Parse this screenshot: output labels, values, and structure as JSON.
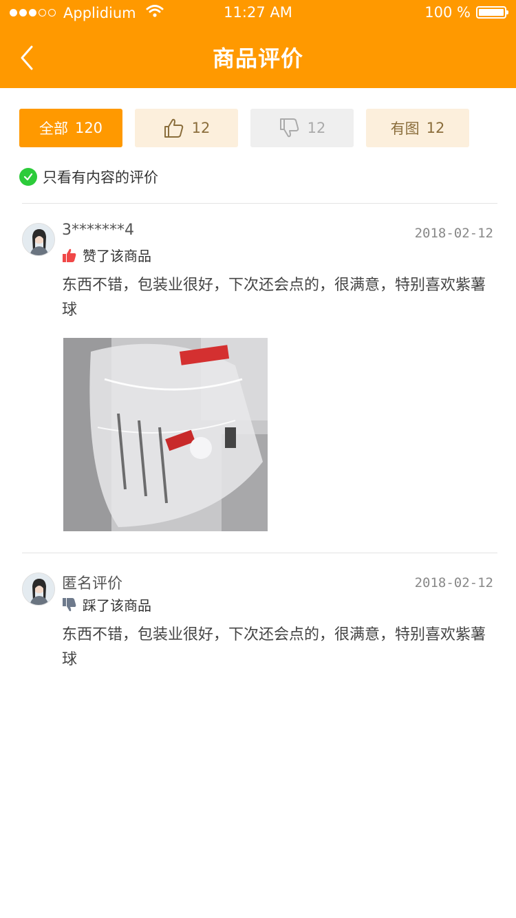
{
  "status_bar": {
    "carrier": "Applidium",
    "time": "11:27 AM",
    "battery": "100 %"
  },
  "nav": {
    "title": "商品评价",
    "back_icon": "chevron-left-icon"
  },
  "filters": [
    {
      "label": "全部",
      "count": "120"
    },
    {
      "icon": "thumbs-up-icon",
      "count": "12"
    },
    {
      "icon": "thumbs-down-icon",
      "count": "12"
    },
    {
      "label": "有图",
      "count": "12"
    }
  ],
  "only_content_label": "只看有内容的评价",
  "reviews": [
    {
      "user": "3*******4",
      "date": "2018-02-12",
      "vote": "赞了该商品",
      "vote_type": "up",
      "content": "东西不错，包装业很好，下次还会点的，很满意，特别喜欢紫薯球",
      "has_photo": true
    },
    {
      "user": "匿名评价",
      "date": "2018-02-12",
      "vote": "踩了该商品",
      "vote_type": "down",
      "content": "东西不错，包装业很好，下次还会点的，很满意，特别喜欢紫薯球",
      "has_photo": false
    }
  ],
  "colors": {
    "brand": "#ff9900",
    "check": "#2ccb3a",
    "thumb_up": "#f04848",
    "thumb_down": "#6e7a8c"
  }
}
